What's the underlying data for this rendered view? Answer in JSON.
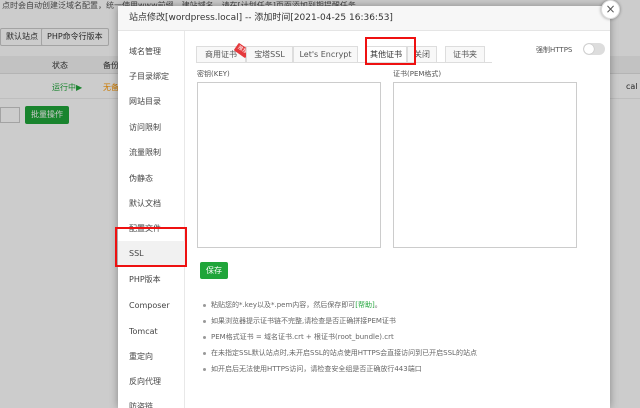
{
  "background": {
    "top_text": "点时会自动创建泛域名配置，统一使用www前缀，建站域名、请在[计划任务]页面添加到期提醒任务",
    "btn_default_site": "默认站点",
    "btn_php_cli": "PHP命令行版本",
    "col_status": "状态",
    "col_backup": "备份",
    "row_status": "运行中▶",
    "row_backup": "无备",
    "row_right": "cal",
    "batch_label": "批量操作"
  },
  "modal": {
    "title": "站点修改[wordpress.local] -- 添加时间[2021-04-25 16:36:53]",
    "close_glyph": "×",
    "sidebar": [
      {
        "label": "域名管理"
      },
      {
        "label": "子目录绑定"
      },
      {
        "label": "网站目录"
      },
      {
        "label": "访问限制"
      },
      {
        "label": "流量限制"
      },
      {
        "label": "伪静态"
      },
      {
        "label": "默认文档"
      },
      {
        "label": "配置文件"
      },
      {
        "label": "SSL"
      },
      {
        "label": "PHP版本"
      },
      {
        "label": "Composer"
      },
      {
        "label": "Tomcat"
      },
      {
        "label": "重定向"
      },
      {
        "label": "反向代理"
      },
      {
        "label": "防盗链"
      }
    ],
    "tabs": [
      {
        "label": "商用证书"
      },
      {
        "label": "宝塔SSL"
      },
      {
        "label": "Let's Encrypt"
      },
      {
        "label": "其他证书"
      },
      {
        "label": "关闭"
      },
      {
        "label": "证书夹"
      }
    ],
    "ribbon_text": "推荐",
    "force_https_label": "强制HTTPS",
    "key_label": "密钥(KEY)",
    "cert_label": "证书(PEM格式)",
    "save_label": "保存",
    "tips": [
      {
        "text": "粘贴您的*.key以及*.pem内容，然后保存即可",
        "link": "[帮助]",
        "after": "。"
      },
      {
        "text": "如果浏览器提示证书链不完整,请检查是否正确拼接PEM证书"
      },
      {
        "text": "PEM格式证书 = 域名证书.crt + 根证书(root_bundle).crt"
      },
      {
        "text": "在未指定SSL默认站点时,未开启SSL的站点使用HTTPS会直接访问到已开启SSL的站点"
      },
      {
        "text": "如开启后无法使用HTTPS访问，请检查安全组是否正确放行443端口"
      }
    ]
  },
  "colors": {
    "accent_green": "#20a53a",
    "highlight_red": "#e11111",
    "ribbon_red": "#e4393c"
  }
}
